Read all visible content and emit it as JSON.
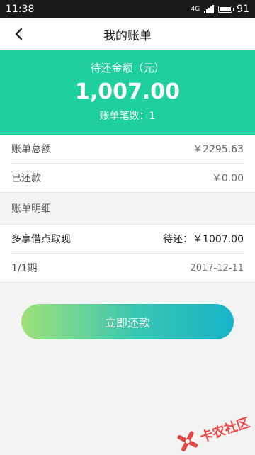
{
  "status": {
    "time": "11:38",
    "network": "4G",
    "battery": "91"
  },
  "header": {
    "title": "我的账单"
  },
  "summary": {
    "pending_label": "待还金额（元）",
    "pending_amount": "1,007.00",
    "bill_count_text": "账单笔数：1"
  },
  "totals": [
    {
      "label": "账单总额",
      "value": "￥2295.63"
    },
    {
      "label": "已还款",
      "value": "￥0.00"
    }
  ],
  "details": {
    "title": "账单明细",
    "item_name": "多享借点取现",
    "item_due": "待还：￥1007.00",
    "period": "1/1期",
    "date": "2017-12-11"
  },
  "actions": {
    "pay_label": "立即还款"
  },
  "watermark": {
    "text": "卡农社区"
  },
  "colors": {
    "hero": "#1fcf9e",
    "watermark": "#e33333"
  }
}
